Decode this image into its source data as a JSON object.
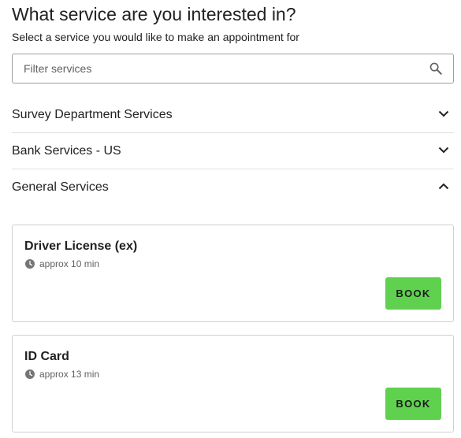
{
  "header": {
    "title": "What service are you interested in?",
    "subtitle": "Select a service you would like to make an appointment for"
  },
  "search": {
    "placeholder": "Filter services",
    "value": "",
    "icon": "search-icon"
  },
  "categories": [
    {
      "label": "Survey Department Services",
      "expanded": false,
      "icon": "chevron-down-icon"
    },
    {
      "label": "Bank Services - US",
      "expanded": false,
      "icon": "chevron-down-icon"
    },
    {
      "label": "General Services",
      "expanded": true,
      "icon": "chevron-up-icon"
    }
  ],
  "services": [
    {
      "name": "Driver License (ex)",
      "duration": "approx 10 min",
      "button_label": "BOOK"
    },
    {
      "name": "ID Card",
      "duration": "approx 13 min",
      "button_label": "BOOK"
    }
  ],
  "colors": {
    "book_button": "#5fd14f",
    "text": "#212121",
    "muted_text": "#616161",
    "border": "#d0d0d0",
    "divider": "#e0e0e0"
  }
}
